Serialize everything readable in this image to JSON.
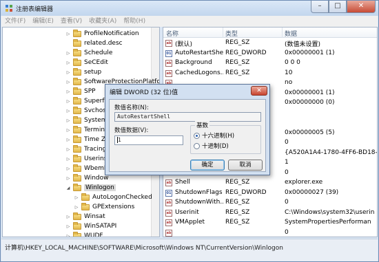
{
  "window": {
    "title": "注册表编辑器",
    "controls": {
      "minimize": "–",
      "maximize": "□",
      "close": "✕"
    }
  },
  "menu": [
    "文件(F)",
    "编辑(E)",
    "查看(V)",
    "收藏夹(A)",
    "帮助(H)"
  ],
  "tree": {
    "items": [
      {
        "label": "ProfileNotification",
        "expand": "▷"
      },
      {
        "label": "related.desc",
        "expand": ""
      },
      {
        "label": "Schedule",
        "expand": "▷"
      },
      {
        "label": "SeCEdit",
        "expand": "▷"
      },
      {
        "label": "setup",
        "expand": "▷"
      },
      {
        "label": "SoftwareProtectionPlatfo",
        "expand": "▷"
      },
      {
        "label": "SPP",
        "expand": "▷"
      },
      {
        "label": "Superfe",
        "expand": "▷"
      },
      {
        "label": "Svchost",
        "expand": "▷"
      },
      {
        "label": "SystemR",
        "expand": "▷"
      },
      {
        "label": "Termina",
        "expand": "▷"
      },
      {
        "label": "Time Zo",
        "expand": "▷"
      },
      {
        "label": "Tracing",
        "expand": "▷"
      },
      {
        "label": "Userinst",
        "expand": "▷"
      },
      {
        "label": "WbemP",
        "expand": "▷"
      },
      {
        "label": "Window",
        "expand": "▷"
      },
      {
        "label": "Winlogon",
        "expand": "◢",
        "selected": true
      },
      {
        "label": "AutoLogonChecked",
        "expand": "▷",
        "child": true
      },
      {
        "label": "GPExtensions",
        "expand": "▷",
        "child": true
      },
      {
        "label": "Winsat",
        "expand": "▷"
      },
      {
        "label": "WinSATAPI",
        "expand": "▷"
      },
      {
        "label": "WUDF",
        "expand": "▷"
      }
    ]
  },
  "list": {
    "headers": {
      "name": "名称",
      "type": "类型",
      "data": "数据"
    },
    "rows": [
      {
        "icon": "ab",
        "name": "(默认)",
        "type": "REG_SZ",
        "data": "(数值未设置)"
      },
      {
        "icon": "bin",
        "name": "AutoRestartShell",
        "type": "REG_DWORD",
        "data": "0x00000001 (1)"
      },
      {
        "icon": "ab",
        "name": "Background",
        "type": "REG_SZ",
        "data": "0 0 0"
      },
      {
        "icon": "ab",
        "name": "CachedLogons...",
        "type": "REG_SZ",
        "data": "10"
      },
      {
        "icon": "ab",
        "name": "",
        "type": "",
        "data": "no"
      },
      {
        "icon": "",
        "name": "",
        "type": "",
        "data": "0x00000001 (1)"
      },
      {
        "icon": "",
        "name": "",
        "type": "",
        "data": "0x00000000 (0)"
      },
      {
        "icon": "",
        "name": "",
        "type": "",
        "data": ""
      },
      {
        "icon": "",
        "name": "",
        "type": "",
        "data": ""
      },
      {
        "icon": "",
        "name": "",
        "type": "",
        "data": "0x00000005 (5)"
      },
      {
        "icon": "",
        "name": "",
        "type": "",
        "data": "0"
      },
      {
        "icon": "",
        "name": "",
        "type": "",
        "data": "{A520A1A4-1780-4FF6-BD18-"
      },
      {
        "icon": "",
        "name": "",
        "type": "",
        "data": "1"
      },
      {
        "icon": "",
        "name": "",
        "type": "",
        "data": "0"
      },
      {
        "icon": "ab",
        "name": "Shell",
        "type": "REG_SZ",
        "data": "explorer.exe"
      },
      {
        "icon": "bin",
        "name": "ShutdownFlags",
        "type": "REG_DWORD",
        "data": "0x00000027 (39)"
      },
      {
        "icon": "ab",
        "name": "ShutdownWith...",
        "type": "REG_SZ",
        "data": "0"
      },
      {
        "icon": "ab",
        "name": "Userinit",
        "type": "REG_SZ",
        "data": "C:\\Windows\\system32\\userin"
      },
      {
        "icon": "ab",
        "name": "VMApplet",
        "type": "REG_SZ",
        "data": "SystemPropertiesPerforman"
      },
      {
        "icon": "ab",
        "name": "",
        "type": "",
        "data": "0"
      }
    ]
  },
  "status": {
    "path": "计算机\\HKEY_LOCAL_MACHINE\\SOFTWARE\\Microsoft\\Windows NT\\CurrentVersion\\Winlogon"
  },
  "dialog": {
    "title": "编辑 DWORD (32 位)值",
    "close": "✕",
    "value_name_label": "数值名称(N):",
    "value_name": "AutoRestartShell",
    "value_data_label": "数值数据(V):",
    "value_data": "1",
    "base_label": "基数",
    "hex_label": "十六进制(H)",
    "dec_label": "十进制(D)",
    "ok": "确定",
    "cancel": "取消"
  }
}
